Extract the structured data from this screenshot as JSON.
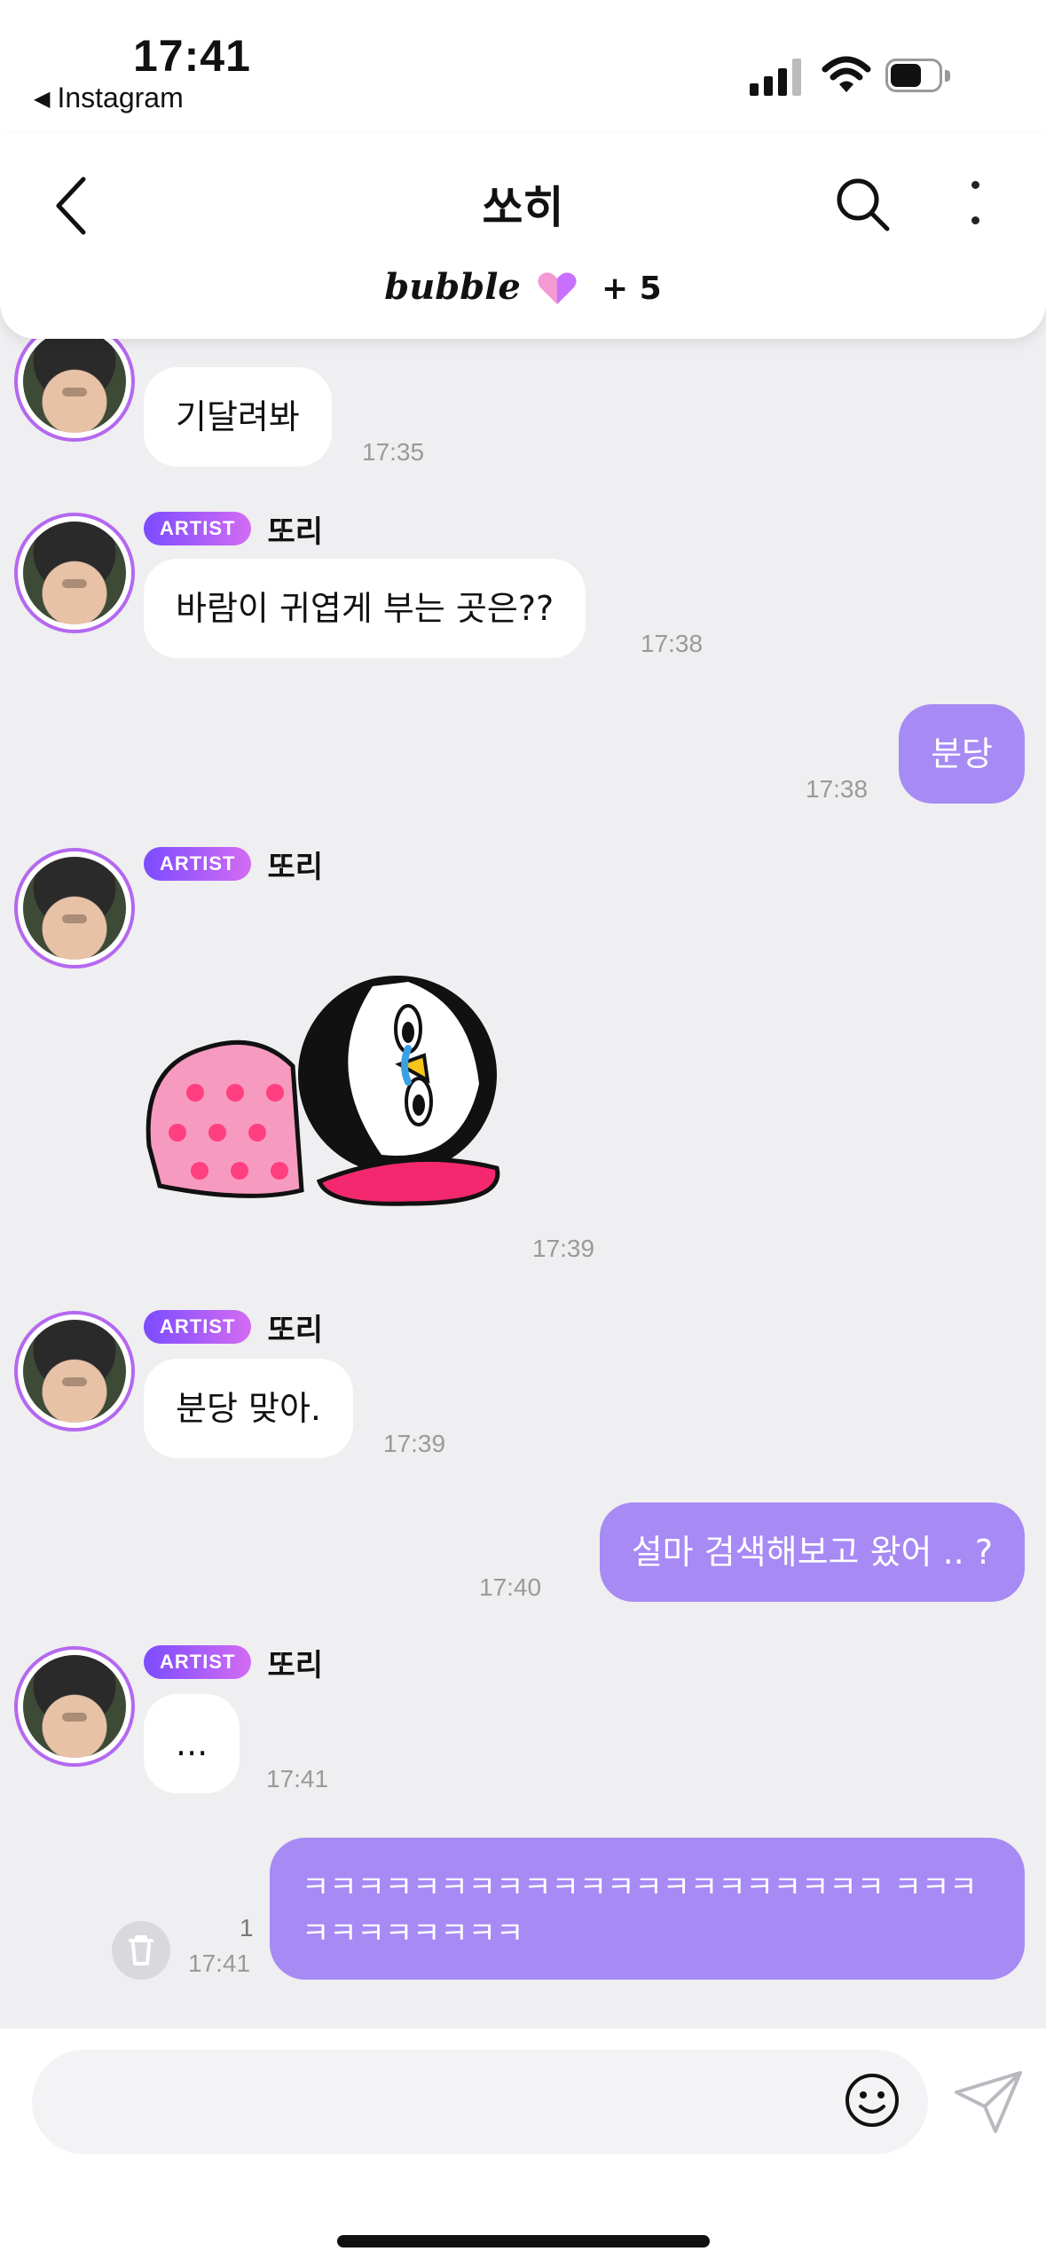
{
  "status_bar": {
    "time": "17:41",
    "back_app": "Instagram"
  },
  "header": {
    "title": "쏘히",
    "subtitle_brand": "bubble",
    "subtitle_count": "+ 5",
    "icons": [
      "back-chevron-icon",
      "search-icon",
      "more-vertical-icon",
      "heart-icon"
    ],
    "heart_colors": [
      "#c970ff",
      "#ffa4c9"
    ]
  },
  "artist_badge": "ARTIST",
  "messages": [
    {
      "from": "또리",
      "text": "기달려봐",
      "time": "17:35"
    },
    {
      "from": "또리",
      "text": "바람이 귀엽게 부는 곳은??",
      "time": "17:38"
    },
    {
      "from": "me",
      "text": "분당",
      "time": "17:38"
    },
    {
      "from": "또리",
      "sticker": "crying-penguin-sticker",
      "time": "17:39"
    },
    {
      "from": "또리",
      "text": "분당 맞아.",
      "time": "17:39"
    },
    {
      "from": "me",
      "text": "설마 검색해보고 왔어 .. ?",
      "time": "17:40"
    },
    {
      "from": "또리",
      "text": "...",
      "time": "17:41"
    },
    {
      "from": "me",
      "text": "ㅋㅋㅋㅋㅋㅋㅋㅋㅋㅋㅋㅋㅋㅋㅋㅋㅋㅋㅋㅋㅋ ㅋㅋㅋㅋㅋㅋㅋㅋㅋㅋㅋ",
      "time": "17:41",
      "unread": "1"
    }
  ],
  "composer": {
    "placeholder": "",
    "icons": [
      "emoji-icon",
      "send-icon",
      "trash-icon"
    ]
  },
  "colors": {
    "outgoing_bubble": "#a78af4",
    "incoming_bubble": "#ffffff",
    "chat_background": "#efeef0",
    "badge_start": "#7b4cff",
    "badge_end": "#d36cf3"
  }
}
